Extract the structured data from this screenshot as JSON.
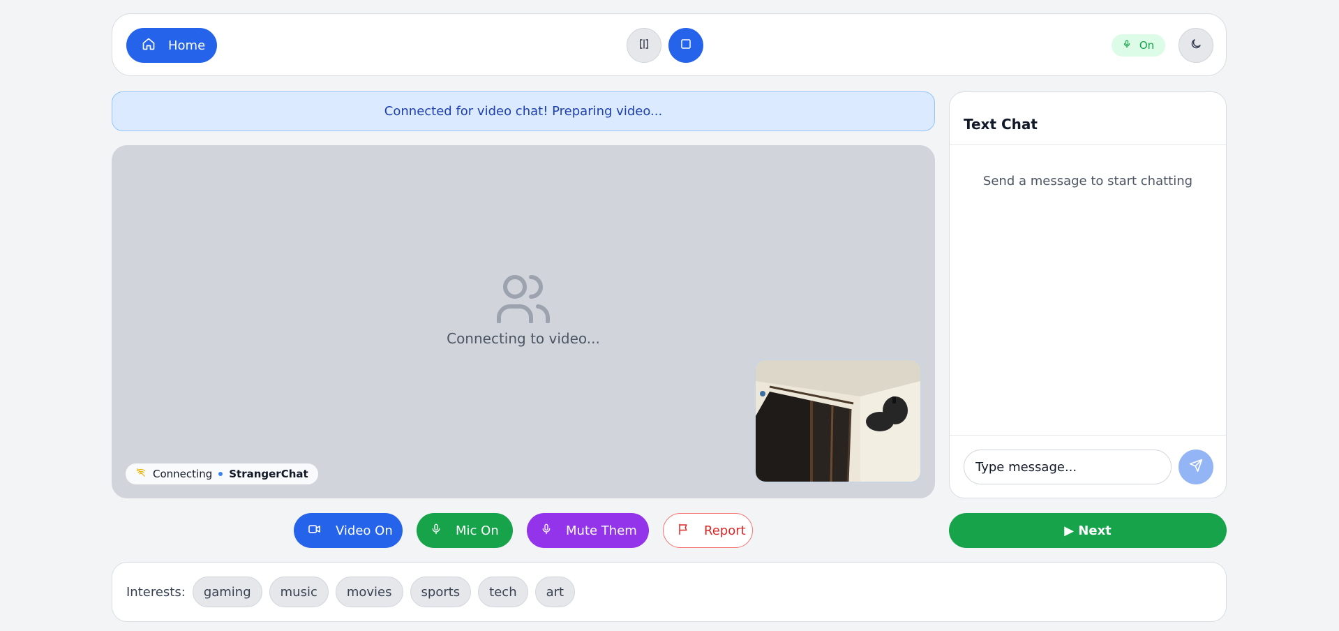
{
  "header": {
    "home_label": "Home",
    "mic_status": "On"
  },
  "banner": {
    "text": "Connected for video chat! Preparing video..."
  },
  "video": {
    "placeholder_text": "Connecting to video...",
    "connection_status": "Connecting",
    "brand": "StrangerChat"
  },
  "chat": {
    "title": "Text Chat",
    "empty_text": "Send a message to start chatting",
    "input_placeholder": "Type message..."
  },
  "controls": {
    "video_label": "Video On",
    "mic_label": "Mic On",
    "mute_label": "Mute Them",
    "report_label": "Report",
    "next_label": "▶ Next"
  },
  "interests": {
    "label": "Interests:",
    "items": [
      "gaming",
      "music",
      "movies",
      "sports",
      "tech",
      "art"
    ]
  },
  "colors": {
    "primary": "#2563eb",
    "success": "#16a34a",
    "purple": "#9333ea",
    "danger": "#dc2626",
    "banner_bg": "#dbeafe"
  }
}
